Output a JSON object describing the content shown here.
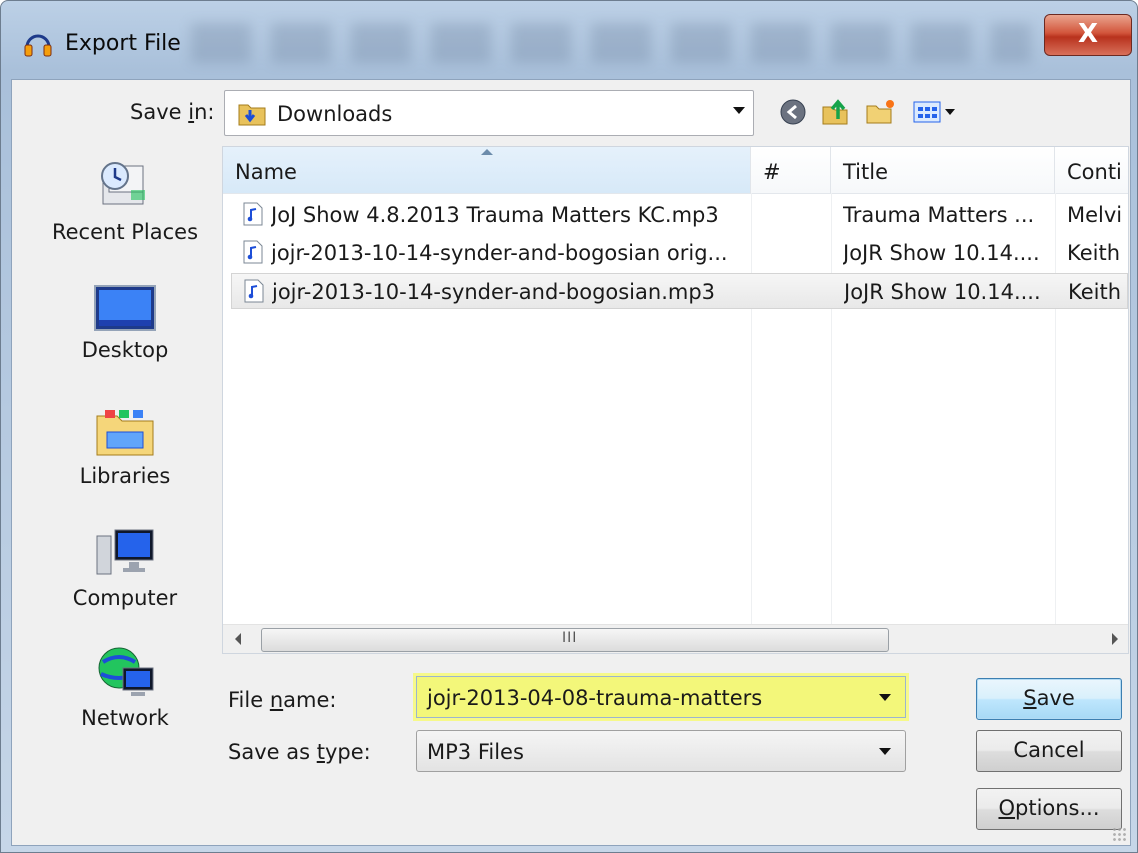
{
  "window": {
    "title": "Export File",
    "close_label": "X"
  },
  "toolbar": {
    "save_in_label_pre": "Save ",
    "save_in_label_acc": "i",
    "save_in_label_post": "n:",
    "save_in_value": "Downloads",
    "icons": [
      "back-icon",
      "up-folder-icon",
      "new-folder-icon",
      "view-menu-icon"
    ]
  },
  "places": [
    {
      "label": "Recent Places",
      "icon": "recent-places-icon"
    },
    {
      "label": "Desktop",
      "icon": "desktop-icon"
    },
    {
      "label": "Libraries",
      "icon": "libraries-icon"
    },
    {
      "label": "Computer",
      "icon": "computer-icon"
    },
    {
      "label": "Network",
      "icon": "network-icon"
    }
  ],
  "columns": {
    "name": "Name",
    "track": "#",
    "title": "Title",
    "contributor": "Conti"
  },
  "files": [
    {
      "name": "JoJ Show 4.8.2013 Trauma Matters KC.mp3",
      "track": "",
      "title": "Trauma Matters ...",
      "contributor": "Melvi",
      "selected": false
    },
    {
      "name": "jojr-2013-10-14-synder-and-bogosian orig...",
      "track": "",
      "title": "JoJR Show 10.14....",
      "contributor": "Keith",
      "selected": false
    },
    {
      "name": "jojr-2013-10-14-synder-and-bogosian.mp3",
      "track": "",
      "title": "JoJR Show 10.14....",
      "contributor": "Keith",
      "selected": true
    }
  ],
  "scrollbar": {
    "grip": "III"
  },
  "form": {
    "file_name_label_pre": "File ",
    "file_name_label_acc": "n",
    "file_name_label_post": "ame:",
    "file_name_value": "jojr-2013-04-08-trauma-matters",
    "save_type_label_pre": "Save as ",
    "save_type_label_acc": "t",
    "save_type_label_post": "ype:",
    "save_type_value": "MP3 Files"
  },
  "buttons": {
    "save_acc": "S",
    "save_rest": "ave",
    "cancel": "Cancel",
    "options_acc": "O",
    "options_rest": "ptions..."
  },
  "colors": {
    "highlight": "#f3f77a",
    "close_red": "#c8432a",
    "selection_border": "#3c7fb1"
  }
}
